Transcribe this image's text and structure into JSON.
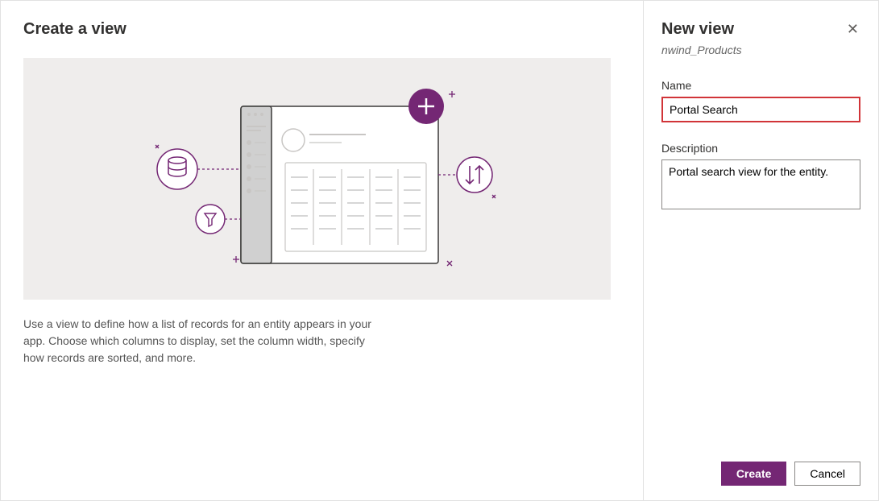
{
  "main": {
    "title": "Create a view",
    "description": "Use a view to define how a list of records for an entity appears in your app. Choose which columns to display, set the column width, specify how records are sorted, and more."
  },
  "side": {
    "title": "New view",
    "subtitle": "nwind_Products",
    "name_label": "Name",
    "name_value": "Portal Search",
    "description_label": "Description",
    "description_value": "Portal search view for the entity."
  },
  "footer": {
    "create_label": "Create",
    "cancel_label": "Cancel"
  }
}
